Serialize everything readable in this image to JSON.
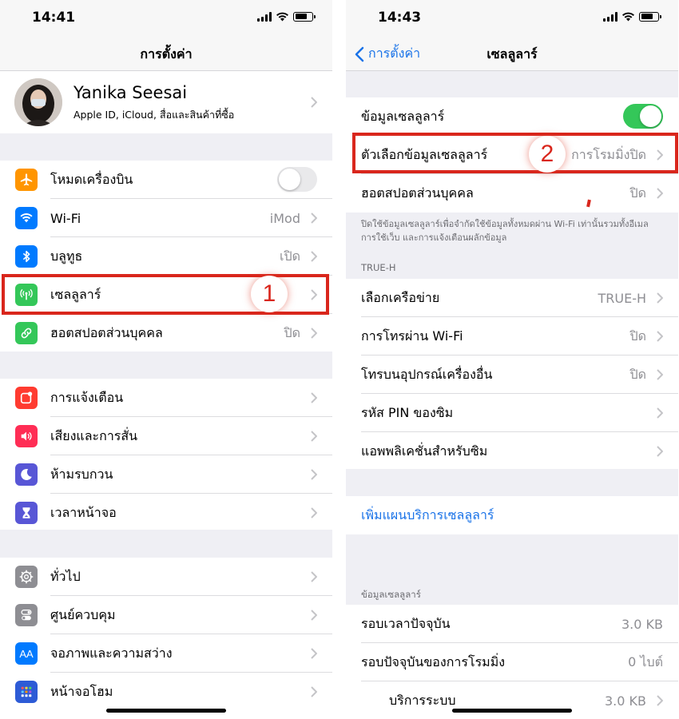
{
  "left": {
    "status_time": "14:41",
    "title": "การตั้งค่า",
    "profile": {
      "name": "Yanika Seesai",
      "subtitle": "Apple ID, iCloud, สื่อและสินค้าที่ซื้อ"
    },
    "group1": [
      {
        "label": "โหมดเครื่องบิน",
        "value": "",
        "icon": "airplane-icon",
        "color": "#ff9500"
      },
      {
        "label": "Wi-Fi",
        "value": "iMod",
        "icon": "wifi-icon",
        "color": "#007aff"
      },
      {
        "label": "บลูทูธ",
        "value": "เปิด",
        "icon": "bluetooth-icon",
        "color": "#007aff"
      },
      {
        "label": "เซลลูลาร์",
        "value": "",
        "icon": "cellular-antenna-icon",
        "color": "#34c759"
      },
      {
        "label": "ฮอตสปอตส่วนบุคคล",
        "value": "ปิด",
        "icon": "hotspot-link-icon",
        "color": "#34c759"
      }
    ],
    "group2": [
      {
        "label": "การแจ้งเตือน",
        "icon": "notifications-icon",
        "color": "#ff3b30"
      },
      {
        "label": "เสียงและการสั่น",
        "icon": "speaker-icon",
        "color": "#ff2d55"
      },
      {
        "label": "ห้ามรบกวน",
        "icon": "moon-icon",
        "color": "#5856d6"
      },
      {
        "label": "เวลาหน้าจอ",
        "icon": "hourglass-icon",
        "color": "#5856d6"
      }
    ],
    "group3": [
      {
        "label": "ทั่วไป",
        "icon": "gear-icon",
        "color": "#8e8e93"
      },
      {
        "label": "ศูนย์ควบคุม",
        "icon": "control-center-icon",
        "color": "#8e8e93"
      },
      {
        "label": "จอภาพและความสว่าง",
        "icon": "display-aa-icon",
        "color": "#007aff",
        "glyph": "AA"
      },
      {
        "label": "หน้าจอโฮม",
        "icon": "home-screen-grid-icon",
        "color": "#2d5bd6"
      }
    ],
    "step_badge": "1"
  },
  "right": {
    "status_time": "14:43",
    "back_label": "การตั้งค่า",
    "title": "เซลลูลาร์",
    "group1": [
      {
        "label": "ข้อมูลเซลลูลาร์",
        "value": ""
      },
      {
        "label": "ตัวเลือกข้อมูลเซลลูลาร์",
        "value": "การโรมมิ่งปิด"
      },
      {
        "label": "ฮอตสปอตส่วนบุคคล",
        "value": "ปิด"
      }
    ],
    "footer_note": "ปิดใช้ข้อมูลเซลลูลาร์เพื่อจำกัดใช้ข้อมูลทั้งหมดผ่าน Wi-Fi เท่านั้นรวมทั้งอีเมล การใช้เว็บ และการแจ้งเตือนผลักข้อมูล",
    "carrier_header": "TRUE-H",
    "group2": [
      {
        "label": "เลือกเครือข่าย",
        "value": "TRUE-H"
      },
      {
        "label": "การโทรผ่าน Wi-Fi",
        "value": "ปิด"
      },
      {
        "label": "โทรบนอุปกรณ์เครื่องอื่น",
        "value": "ปิด"
      },
      {
        "label": "รหัส PIN ของซิม",
        "value": ""
      },
      {
        "label": "แอพพลิเคชั่นสำหรับซิม",
        "value": ""
      }
    ],
    "add_plan": "เพิ่มแผนบริการเซลลูลาร์",
    "data_header": "ข้อมูลเซลลูลาร์",
    "group3": [
      {
        "label": "รอบเวลาปัจจุบัน",
        "value": "3.0 KB"
      },
      {
        "label": "รอบปัจจุบันของการโรมมิ่ง",
        "value": "0 ไบต์"
      },
      {
        "label": "บริการระบบ",
        "value": "3.0 KB"
      }
    ],
    "step_badge": "2"
  },
  "colors": {
    "accent": "#1a73e8",
    "highlight": "#d9261c",
    "toggle_on": "#34c759"
  }
}
